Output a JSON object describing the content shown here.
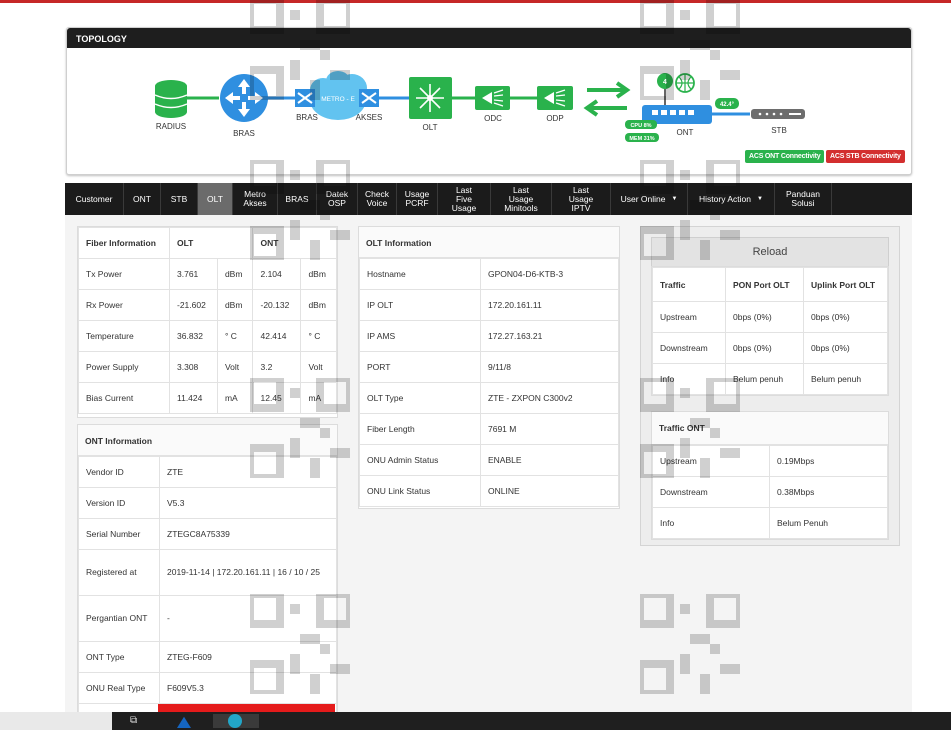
{
  "topology": {
    "title": "TOPOLOGY",
    "nodes": {
      "radius": "RADIUS",
      "bras": "BRAS",
      "bras2": "BRAS",
      "metro": "METRO - E",
      "akses": "AKSES",
      "olt": "OLT",
      "odc": "ODC",
      "odp": "ODP",
      "ont": "ONT",
      "stb": "STB"
    },
    "ont_badges": {
      "cpu": "CPU 8%",
      "mem": "MEM 31%",
      "temp": "42.4°"
    },
    "wifi_count": "4",
    "acs_ont": "ACS ONT Connectivity",
    "acs_stb": "ACS STB Connectivity",
    "colors": {
      "green": "#2ab24c",
      "blue": "#2f8fe0",
      "cloud": "#62c3f0",
      "red": "#d32f2f"
    }
  },
  "nav": {
    "items": [
      {
        "label": "Customer"
      },
      {
        "label": "ONT"
      },
      {
        "label": "STB"
      },
      {
        "label": "OLT",
        "active": true
      },
      {
        "label": "Metro\nAkses"
      },
      {
        "label": "BRAS"
      },
      {
        "label": "Datek\nOSP"
      },
      {
        "label": "Check\nVoice"
      },
      {
        "label": "Usage\nPCRF"
      },
      {
        "label": "Last Five\nUsage"
      },
      {
        "label": "Last Usage\nMinitools"
      },
      {
        "label": "Last Usage\nIPTV"
      },
      {
        "label": "User Online",
        "dropdown": true
      },
      {
        "label": "History Action",
        "dropdown": true
      },
      {
        "label": "Panduan\nSolusi"
      }
    ]
  },
  "fiber": {
    "headers": [
      "Fiber Information",
      "OLT",
      "ONT"
    ],
    "rows": [
      {
        "label": "Tx Power",
        "olt": "3.761",
        "olt_unit": "dBm",
        "ont": "2.104",
        "ont_unit": "dBm"
      },
      {
        "label": "Rx Power",
        "olt": "-21.602",
        "olt_unit": "dBm",
        "ont": "-20.132",
        "ont_unit": "dBm"
      },
      {
        "label": "Temperature",
        "olt": "36.832",
        "olt_unit": "° C",
        "ont": "42.414",
        "ont_unit": "° C"
      },
      {
        "label": "Power Supply",
        "olt": "3.308",
        "olt_unit": "Volt",
        "ont": "3.2",
        "ont_unit": "Volt"
      },
      {
        "label": "Bias Current",
        "olt": "11.424",
        "olt_unit": "mA",
        "ont": "12.45",
        "ont_unit": "mA"
      }
    ]
  },
  "ont_info": {
    "title": "ONT Information",
    "rows": [
      {
        "label": "Vendor ID",
        "value": "ZTE"
      },
      {
        "label": "Version ID",
        "value": "V5.3"
      },
      {
        "label": "Serial Number",
        "value": "ZTEGC8A75339"
      },
      {
        "label": "Registered at",
        "value": "2019-11-14 | 172.20.161.11 | 16 / 10 / 25"
      },
      {
        "label": "Pergantian ONT",
        "value": "-"
      },
      {
        "label": "ONT Type",
        "value": "ZTEG-F609"
      },
      {
        "label": "ONU Real Type",
        "value": "F609V5.3"
      }
    ]
  },
  "olt_info": {
    "title": "OLT Information",
    "rows": [
      {
        "label": "Hostname",
        "value": "GPON04-D6-KTB-3"
      },
      {
        "label": "IP OLT",
        "value": "172.20.161.11"
      },
      {
        "label": "IP AMS",
        "value": "172.27.163.21"
      },
      {
        "label": "PORT",
        "value": "9/11/8"
      },
      {
        "label": "OLT Type",
        "value": "ZTE - ZXPON C300v2"
      },
      {
        "label": "Fiber Length",
        "value": "7691 M"
      },
      {
        "label": "ONU Admin Status",
        "value": "ENABLE"
      },
      {
        "label": "ONU Link Status",
        "value": "ONLINE"
      }
    ]
  },
  "traffic": {
    "reload": "Reload",
    "headers": [
      "Traffic",
      "PON Port OLT",
      "Uplink Port OLT"
    ],
    "rows": [
      {
        "label": "Upstream",
        "pon": "0bps (0%)",
        "uplink": "0bps (0%)"
      },
      {
        "label": "Downstream",
        "pon": "0bps (0%)",
        "uplink": "0bps (0%)"
      },
      {
        "label": "Info",
        "pon": "Belum penuh",
        "uplink": "Belum penuh"
      }
    ]
  },
  "traffic_ont": {
    "title": "Traffic ONT",
    "rows": [
      {
        "label": "Upstream",
        "value": "0.19Mbps"
      },
      {
        "label": "Downstream",
        "value": "0.38Mbps"
      },
      {
        "label": "Info",
        "value": "Belum Penuh"
      }
    ]
  }
}
